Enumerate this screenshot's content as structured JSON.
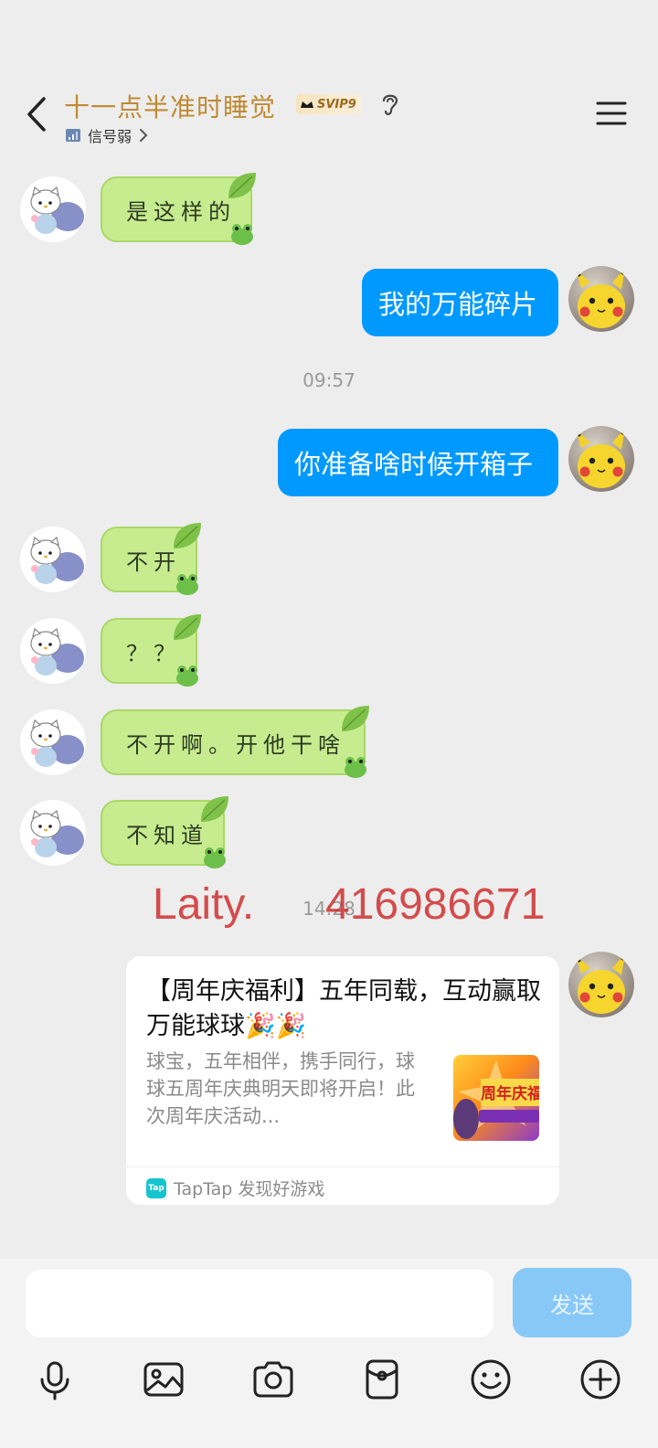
{
  "header": {
    "title": "十一点半准时睡觉",
    "badge": "SVIP9",
    "status": "信号弱"
  },
  "messages": [
    {
      "side": "left",
      "text": "是这样的"
    },
    {
      "side": "right",
      "text": "我的万能碎片"
    },
    {
      "type": "time",
      "text": "09:57"
    },
    {
      "side": "right",
      "text": "你准备啥时候开箱子"
    },
    {
      "side": "left",
      "text": "不开"
    },
    {
      "side": "left",
      "text": "？？"
    },
    {
      "side": "left",
      "text": "不开啊。开他干啥"
    },
    {
      "side": "left",
      "text": "不知道"
    },
    {
      "type": "time",
      "text": "14:28"
    }
  ],
  "watermark": {
    "left": "Laity.",
    "right": "416986671"
  },
  "share_card": {
    "title": "【周年庆福利】五年同载，互动赢取万能球球🎉🎉",
    "description": "球宝，五年相伴，携手同行，球球五周年庆典明天即将开启！此次周年庆活动...",
    "thumb_text": "周年庆福",
    "source_logo": "Tap",
    "source": "TapTap 发现好游戏"
  },
  "input": {
    "placeholder": "",
    "send_label": "发送"
  },
  "toolbar": [
    "microphone-icon",
    "image-icon",
    "camera-icon",
    "red-packet-icon",
    "emoji-icon",
    "plus-icon"
  ],
  "colors": {
    "title": "#c08a34",
    "blue_bubble": "#0099ff",
    "green_bubble": "#c7ec8f",
    "send_button": "#87c8f7"
  }
}
